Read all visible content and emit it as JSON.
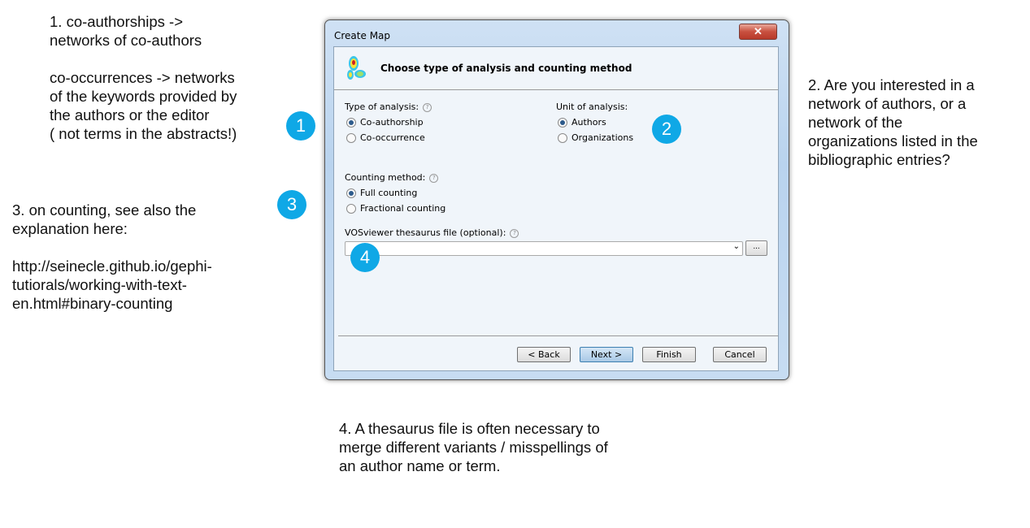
{
  "annotations": {
    "note1": "1. co-authorships ->\nnetworks of co-authors\n\nco-occurrences -> networks\nof the keywords provided by\nthe authors or the editor\n( not terms in the abstracts!)",
    "note2": "2. Are you interested in a\nnetwork of authors, or a\nnetwork of the\norganizations listed in the\nbibliographic entries?",
    "note3": "3. on counting, see also the\nexplanation here:\n\nhttp://seinecle.github.io/gephi-\ntutiorals/working-with-text-\nen.html#binary-counting",
    "note4": "4. A thesaurus file is often necessary to\nmerge different variants / misspellings of\nan author name or term.",
    "badges": [
      "1",
      "2",
      "3",
      "4"
    ],
    "badge_color": "#0fa8e6"
  },
  "dialog": {
    "title": "Create Map",
    "close": "✕",
    "header": "Choose type of analysis and counting method",
    "type_label": "Type of analysis:",
    "type_options": [
      {
        "label": "Co-authorship",
        "selected": true
      },
      {
        "label": "Co-occurrence",
        "selected": false
      }
    ],
    "unit_label": "Unit of analysis:",
    "unit_options": [
      {
        "label": "Authors",
        "selected": true
      },
      {
        "label": "Organizations",
        "selected": false
      }
    ],
    "counting_label": "Counting method:",
    "counting_options": [
      {
        "label": "Full counting",
        "selected": true
      },
      {
        "label": "Fractional counting",
        "selected": false
      }
    ],
    "thesaurus_label": "VOSviewer thesaurus file (optional):",
    "thesaurus_value": "",
    "browse": "...",
    "help": "?",
    "buttons": {
      "back": "< Back",
      "next": "Next >",
      "finish": "Finish",
      "cancel": "Cancel"
    }
  }
}
